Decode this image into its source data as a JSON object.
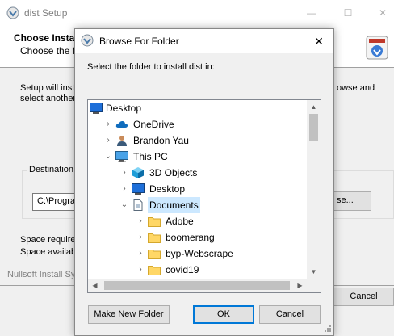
{
  "background_window": {
    "title": "dist Setup",
    "controls": {
      "minimize": "—",
      "maximize": "☐",
      "close": "✕"
    },
    "heading": "Choose Instal",
    "subheading": "Choose the fo",
    "description_left": [
      "Setup will insta",
      "select another"
    ],
    "description_right": "owse and",
    "destination_label": "Destination f",
    "path_value": "C:\\Progra",
    "browse_label": "se...",
    "space_required": "Space require",
    "space_available": "Space availab",
    "footer": "Nullsoft Install Sy",
    "cancel_label": "Cancel"
  },
  "dialog": {
    "title": "Browse For Folder",
    "close": "✕",
    "instruction": "Select the folder to install dist in:",
    "tree": [
      {
        "label": "Desktop",
        "icon": "desktop-icon",
        "chevron": "",
        "level": 0,
        "selected": false
      },
      {
        "label": "OneDrive",
        "icon": "cloud-icon",
        "chevron": "›",
        "level": 1,
        "selected": false
      },
      {
        "label": "Brandon Yau",
        "icon": "user-icon",
        "chevron": "›",
        "level": 1,
        "selected": false
      },
      {
        "label": "This PC",
        "icon": "computer-icon",
        "chevron": "⌄",
        "level": 1,
        "selected": false
      },
      {
        "label": "3D Objects",
        "icon": "cube-icon",
        "chevron": "›",
        "level": 2,
        "selected": false
      },
      {
        "label": "Desktop",
        "icon": "desktop-icon",
        "chevron": "›",
        "level": 2,
        "selected": false
      },
      {
        "label": "Documents",
        "icon": "document-icon",
        "chevron": "⌄",
        "level": 2,
        "selected": true
      },
      {
        "label": "Adobe",
        "icon": "folder-icon",
        "chevron": "›",
        "level": 3,
        "selected": false
      },
      {
        "label": "boomerang",
        "icon": "folder-icon",
        "chevron": "›",
        "level": 3,
        "selected": false
      },
      {
        "label": "byp-Webscrape",
        "icon": "folder-icon",
        "chevron": "›",
        "level": 3,
        "selected": false
      },
      {
        "label": "covid19",
        "icon": "folder-icon",
        "chevron": "›",
        "level": 3,
        "selected": false
      },
      {
        "label": "",
        "icon": "folder-icon",
        "chevron": "",
        "level": 3,
        "selected": false
      }
    ],
    "scroll": {
      "up": "▲",
      "down": "▼",
      "left": "◀",
      "right": "▶"
    },
    "buttons": {
      "new_folder": "Make New Folder",
      "ok": "OK",
      "cancel": "Cancel"
    }
  },
  "colors": {
    "selection": "#cce8ff",
    "accent": "#0078d7",
    "folder": "#ffd766",
    "cloud": "#0f6cbd"
  }
}
